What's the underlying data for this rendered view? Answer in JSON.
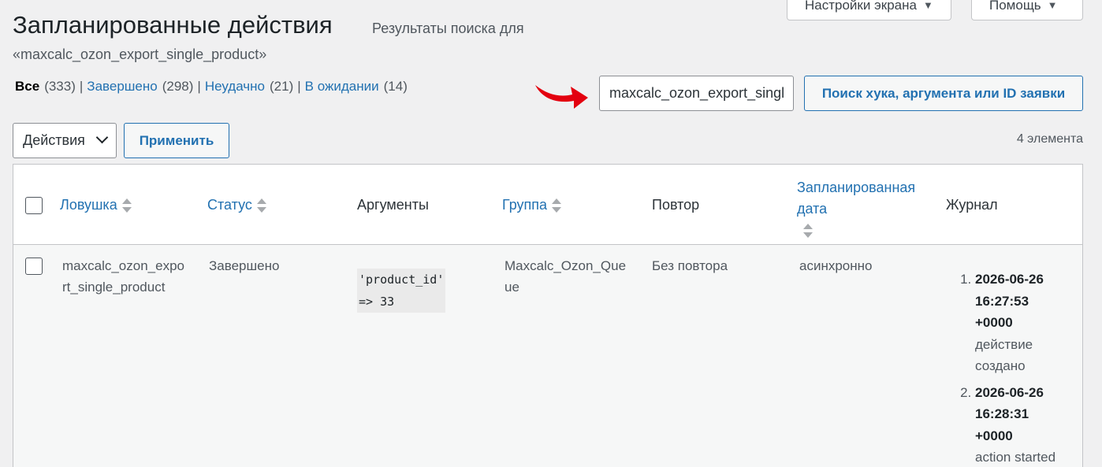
{
  "header": {
    "screen_options_label": "Настройки экрана",
    "help_label": "Помощь",
    "title": "Запланированные действия",
    "subtitle_prefix": "Результаты поиска для",
    "subtitle_query": "«maxcalc_ozon_export_single_product»"
  },
  "views": [
    {
      "label": "Все",
      "count": "(333)",
      "current": true
    },
    {
      "label": "Завершено",
      "count": "(298)"
    },
    {
      "label": "Неудачно",
      "count": "(21)"
    },
    {
      "label": "В ожидании",
      "count": "(14)"
    }
  ],
  "search": {
    "value": "maxcalc_ozon_export_single_product",
    "button_label": "Поиск хука, аргумента или ID заявки"
  },
  "bulk": {
    "selected": "Действия",
    "apply_label": "Применить"
  },
  "items_count": "4 элемента",
  "table": {
    "columns": {
      "hook": "Ловушка",
      "status": "Статус",
      "args": "Аргументы",
      "group": "Группа",
      "recurrence": "Повтор",
      "scheduled_1": "Запланированная",
      "scheduled_2": "дата",
      "log": "Журнал"
    },
    "row": {
      "hook_1": "maxcalc_ozon_expo",
      "hook_2": "rt_single_product",
      "status": "Завершено",
      "args_1": "'product_id'",
      "args_2": "=> 33",
      "group_1": "Maxcalc_Ozon_Que",
      "group_2": "ue",
      "recurrence": "Без повтора",
      "scheduled": "асинхронно",
      "log": [
        {
          "d": "2026-06-26",
          "t": "16:27:53",
          "z": "+0000",
          "m1": "действие",
          "m2": "создано"
        },
        {
          "d": "2026-06-26",
          "t": "16:28:31",
          "z": "+0000",
          "m1": "action started",
          "m2": ""
        }
      ]
    }
  },
  "colors": {
    "link": "#2271b1",
    "arrow": "#e3000f"
  }
}
